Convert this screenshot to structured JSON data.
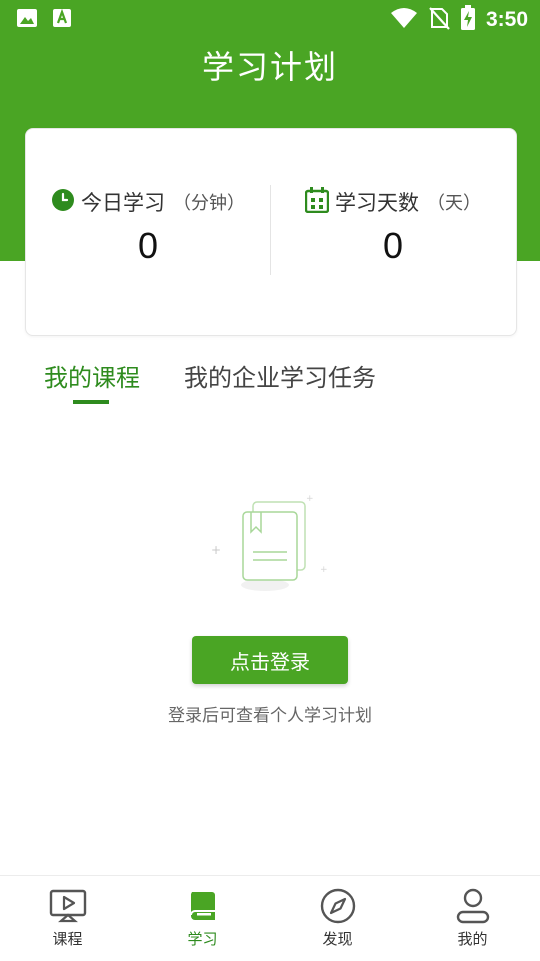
{
  "status_bar": {
    "time": "3:50",
    "left_icons": [
      "image-icon",
      "a-letter-icon"
    ],
    "right_icons": [
      "wifi-icon",
      "no-sim-icon",
      "battery-charging-icon"
    ]
  },
  "header": {
    "title": "学习计划"
  },
  "stats": {
    "today": {
      "label": "今日学习",
      "unit": "（分钟）",
      "value": "0",
      "icon": "clock-icon"
    },
    "days": {
      "label": "学习天数",
      "unit": "（天）",
      "value": "0",
      "icon": "calendar-icon"
    }
  },
  "tabs": [
    {
      "label": "我的课程",
      "active": true
    },
    {
      "label": "我的企业学习任务",
      "active": false
    }
  ],
  "empty_state": {
    "icon": "empty-books-icon",
    "login_button": "点击登录",
    "hint": "登录后可查看个人学习计划"
  },
  "bottom_nav": [
    {
      "label": "课程",
      "icon": "monitor-play-icon",
      "active": false
    },
    {
      "label": "学习",
      "icon": "book-icon",
      "active": true
    },
    {
      "label": "发现",
      "icon": "compass-icon",
      "active": false
    },
    {
      "label": "我的",
      "icon": "user-icon",
      "active": false
    }
  ],
  "colors": {
    "primary": "#4aa524",
    "primary_dark": "#2e8b1e",
    "text": "#333333",
    "muted": "#666666"
  }
}
